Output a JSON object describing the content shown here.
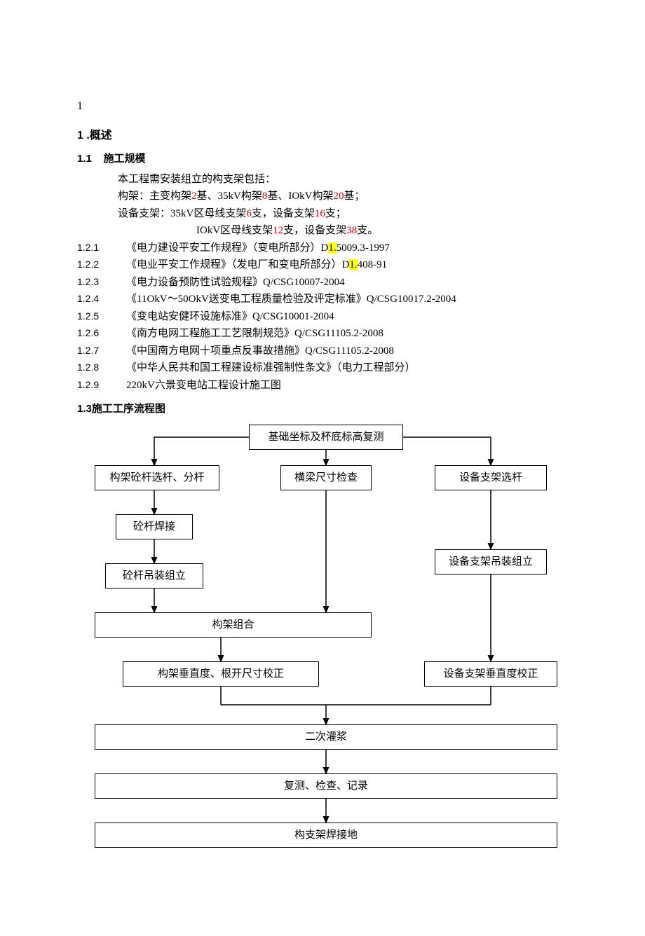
{
  "page_number": "1",
  "section1": {
    "num": "1",
    "title": ".概述"
  },
  "section11": {
    "num": "1.1",
    "title": "施工规模"
  },
  "intro_line": "本工程需安装组立的构支架包括：",
  "frame_line_prefix": "构架：主变构架",
  "frame_v1": "2",
  "frame_mid1": "基、35kV构架",
  "frame_v2": "8",
  "frame_mid2": "基、IOkV构架",
  "frame_v3": "20",
  "frame_suffix": "基；",
  "equip_line_prefix": "设备支架：35kV区母线支架",
  "equip_v1": "6",
  "equip_mid1": "支，设备支架",
  "equip_v2": "16",
  "equip_suffix1": "支；",
  "equip2_prefix": "IOkV区母线支架",
  "equip2_v1": "12",
  "equip2_mid": "支，设备支架",
  "equip2_v2": "38",
  "equip2_suffix": "支。",
  "refs": [
    {
      "num": "1.2.1",
      "pre": "《电力建设平安工作规程》（变电所部分）D",
      "hl": "1.",
      "post": "5009.3-1997"
    },
    {
      "num": "1.2.2",
      "pre": "《电业平安工作规程》（发电厂和变电所部分）D",
      "hl": "1.",
      "post": "408-91"
    },
    {
      "num": "1.2.3",
      "pre": "《电力设备预防性试验规程》Q/CSG10007-2004",
      "hl": "",
      "post": ""
    },
    {
      "num": "1.2.4",
      "pre": "《11OkV～50OkV送变电工程质量检验及评定标准》Q/CSG10017.2-2004",
      "hl": "",
      "post": ""
    },
    {
      "num": "1.2.5",
      "pre": "《变电站安健环设施标准》Q/CSG10001-2004",
      "hl": "",
      "post": ""
    },
    {
      "num": "1.2.6",
      "pre": "《南方电网工程施工工艺限制规范》Q/CSG11105.2-2008",
      "hl": "",
      "post": ""
    },
    {
      "num": "1.2.7",
      "pre": "《中国南方电网十项重点反事故措施》Q/CSG11105.2-2008",
      "hl": "",
      "post": ""
    },
    {
      "num": "1.2.8",
      "pre": "《中华人民共和国工程建设标准强制性条文》（电力工程部分）",
      "hl": "",
      "post": ""
    },
    {
      "num": "1.2.9",
      "pre": "220kV六景变电站工程设计施工图",
      "hl": "",
      "post": ""
    }
  ],
  "section13": "1.3施工工序流程图",
  "flow": {
    "top": "基础坐标及杯底标高复测",
    "left1": "构架砼杆选杆、分杆",
    "mid1": "横梁尺寸检查",
    "right1": "设备支架选杆",
    "left2": "砼杆焊接",
    "left3": "砼杆吊装组立",
    "right2": "设备支架吊装组立",
    "left4": "构架组合",
    "left5": "构架垂直度、根开尺寸校正",
    "right3": "设备支架垂直度校正",
    "b1": "二次灌浆",
    "b2": "复测、检查、记录",
    "b3": "构支架焊接地"
  }
}
